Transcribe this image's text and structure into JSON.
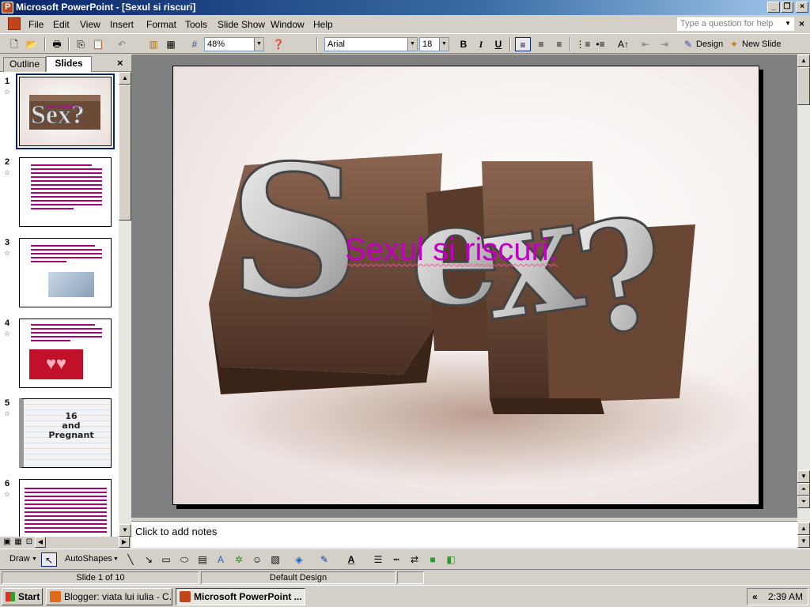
{
  "window": {
    "title": "Microsoft PowerPoint - [Sexul si riscuri]"
  },
  "menu": {
    "items": [
      "File",
      "Edit",
      "View",
      "Insert",
      "Format",
      "Tools",
      "Slide Show",
      "Window",
      "Help"
    ],
    "help_placeholder": "Type a question for help"
  },
  "toolbar": {
    "zoom": "48%",
    "font": "Arial",
    "font_size": "18",
    "bold": "B",
    "italic": "I",
    "underline": "U",
    "design_label": "Design",
    "new_slide_label": "New Slide"
  },
  "left_pane": {
    "tabs": [
      "Outline",
      "Slides"
    ],
    "active_tab": "Slides",
    "slides": [
      {
        "num": "1",
        "kind": "title-image"
      },
      {
        "num": "2",
        "kind": "text"
      },
      {
        "num": "3",
        "kind": "text-image"
      },
      {
        "num": "4",
        "kind": "text-hearts"
      },
      {
        "num": "5",
        "kind": "image-16-pregnant"
      },
      {
        "num": "6",
        "kind": "text"
      }
    ],
    "thumb5_lines": [
      "16",
      "and",
      "Pregnant"
    ]
  },
  "slide": {
    "title": "Sexul si riscuri."
  },
  "notes": {
    "placeholder": "Click to add notes"
  },
  "drawbar": {
    "draw_label": "Draw",
    "autoshapes_label": "AutoShapes"
  },
  "status": {
    "slide_position": "Slide 1 of 10",
    "design": "Default Design"
  },
  "taskbar": {
    "start_label": "Start",
    "tasks": [
      "Blogger: viata lui iulia - C...",
      "Microsoft PowerPoint ..."
    ],
    "clock": "2:39 AM"
  },
  "colors": {
    "title_accent": "#c000c0",
    "titlebar_start": "#0a246a",
    "titlebar_end": "#a6caf0",
    "window_face": "#d4d0c8"
  }
}
